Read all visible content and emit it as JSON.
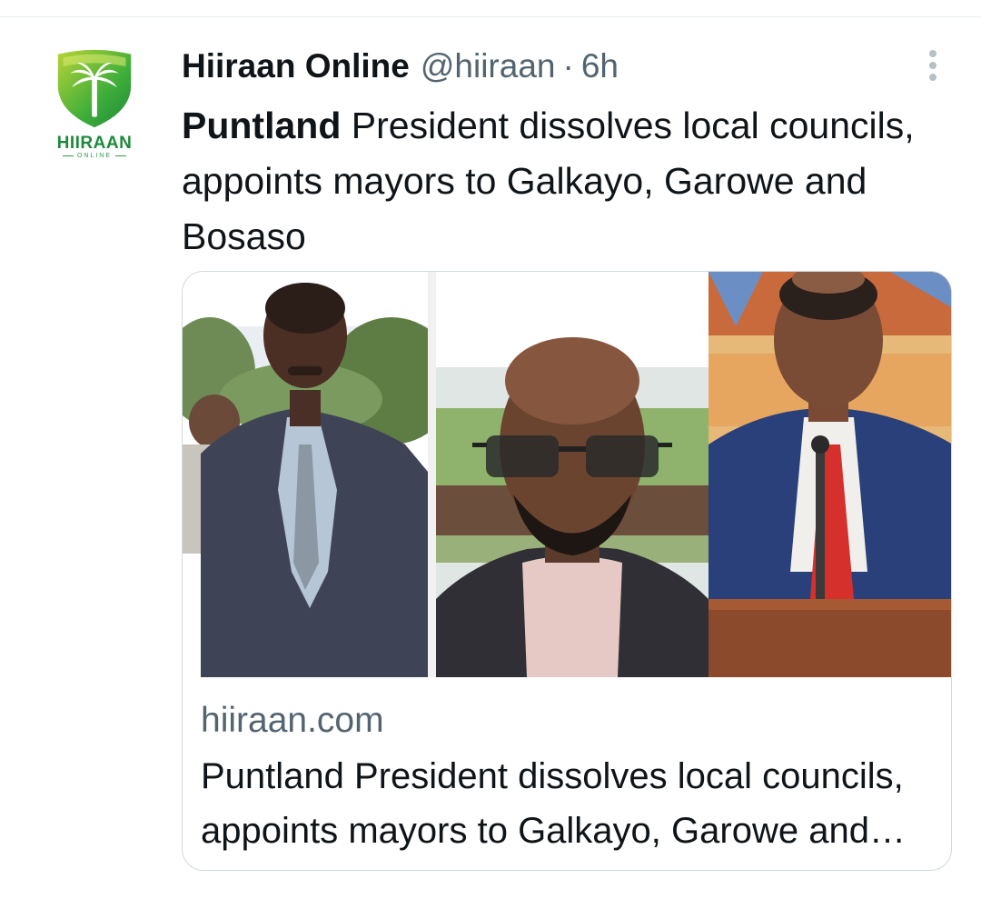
{
  "tweet": {
    "author": {
      "display_name": "Hiiraan Online",
      "handle": "@hiiraan",
      "avatar_brand": "HIIRAAN",
      "avatar_brand_sub": "ONLINE"
    },
    "separator": "·",
    "time": "6h",
    "text_bold": "Puntland",
    "text_rest": " President dissolves local councils, appoints mayors to Galkayo, Garowe and Bosaso",
    "card": {
      "domain": "hiiraan.com",
      "title": "Puntland President dissolves local councils, appoints mayors to Galkayo, Garowe and Bosaso"
    }
  },
  "colors": {
    "brand_green": "#1d8a3a",
    "secondary_text": "#536471",
    "border": "#cfd9de"
  },
  "icons": {
    "more": "more-options-icon",
    "avatar": "palm-shield-logo-icon"
  }
}
